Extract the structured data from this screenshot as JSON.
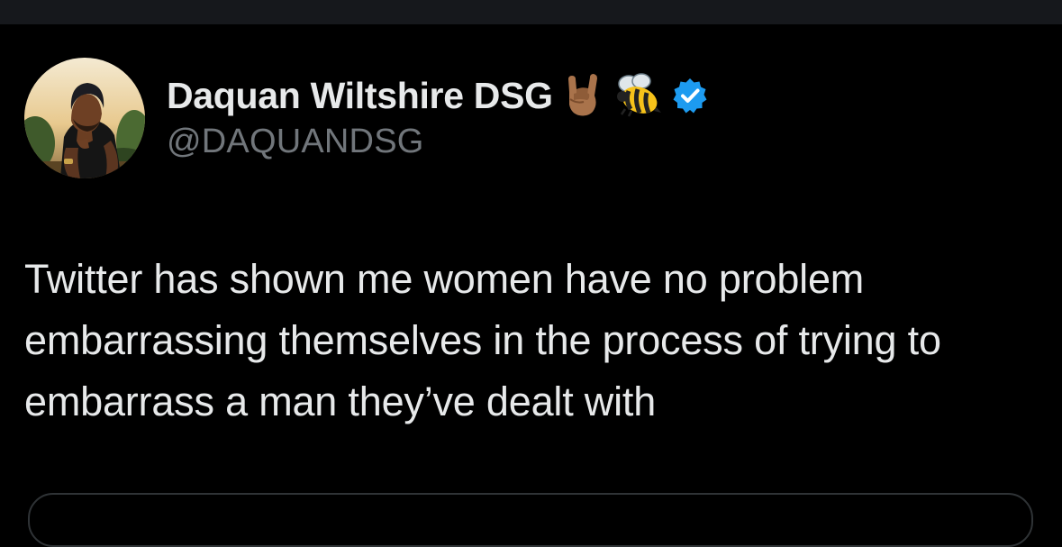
{
  "tweet": {
    "author": {
      "display_name": "Daquan Wiltshire DSG",
      "handle": "@DAQUANDSG",
      "name_emojis": [
        "sign-of-the-horns-medium-dark-skin-tone",
        "honeybee"
      ],
      "verified": true,
      "verified_badge_color": "#1d9bf0"
    },
    "text": "Twitter has shown me women have no problem embarrassing themselves in the process of trying to embarrass a man they’ve dealt with"
  },
  "theme": {
    "background": "#000000",
    "top_bar": "#16181c",
    "primary_text": "#e7e9ea",
    "secondary_text": "#71767b",
    "border": "#2f3336"
  }
}
